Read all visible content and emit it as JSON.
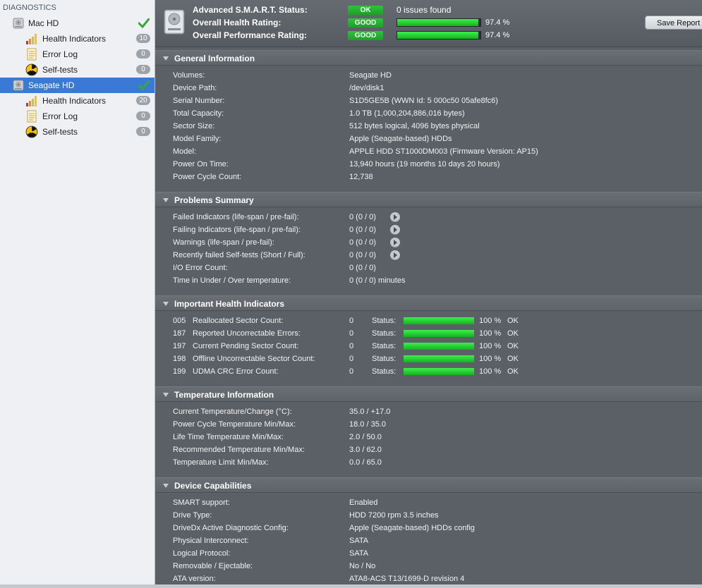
{
  "sidebar": {
    "section_title": "DIAGNOSTICS",
    "drives": [
      {
        "name": "Mac HD",
        "selected": false,
        "children": [
          {
            "label": "Health Indicators",
            "icon": "bar-chart-icon",
            "count": "10"
          },
          {
            "label": "Error Log",
            "icon": "document-icon",
            "count": "0"
          },
          {
            "label": "Self-tests",
            "icon": "radiation-icon",
            "count": "0"
          }
        ]
      },
      {
        "name": "Seagate HD",
        "selected": true,
        "children": [
          {
            "label": "Health Indicators",
            "icon": "bar-chart-icon",
            "count": "20"
          },
          {
            "label": "Error Log",
            "icon": "document-icon",
            "count": "0"
          },
          {
            "label": "Self-tests",
            "icon": "radiation-icon",
            "count": "0"
          }
        ]
      }
    ]
  },
  "summary": {
    "smart_status_label": "Advanced S.M.A.R.T. Status:",
    "smart_status_value": "OK",
    "issues": "0 issues found",
    "health_label": "Overall Health Rating:",
    "health_value": "GOOD",
    "health_level": 0.974,
    "health_pct": "97.4 %",
    "performance_label": "Overall Performance Rating:",
    "performance_value": "GOOD",
    "performance_level": 0.974,
    "performance_pct": "97.4 %",
    "save_button": "Save Report"
  },
  "colors": {
    "good_green": "#22b22e",
    "selected_blue": "#3b79d6",
    "panel_bg": "#5b6066"
  },
  "general": {
    "title": "General Information",
    "rows": [
      {
        "label": "Volumes:",
        "value": "Seagate HD"
      },
      {
        "label": "Device Path:",
        "value": "/dev/disk1"
      },
      {
        "label": "Serial Number:",
        "value": "S1D5GE5B (WWN Id: 5 000c50 05afe8fc6)"
      },
      {
        "label": "Total Capacity:",
        "value": "1.0 TB (1,000,204,886,016 bytes)"
      },
      {
        "label": "Sector Size:",
        "value": "512 bytes logical, 4096 bytes physical"
      },
      {
        "label": "Model Family:",
        "value": "Apple (Seagate-based) HDDs"
      },
      {
        "label": "Model:",
        "value": "APPLE HDD ST1000DM003  (Firmware Version: AP15)"
      },
      {
        "label": "Power On Time:",
        "value": "13,940 hours (19 months 10 days 20 hours)"
      },
      {
        "label": "Power Cycle Count:",
        "value": "12,738"
      }
    ]
  },
  "problems": {
    "title": "Problems Summary",
    "rows": [
      {
        "label": "Failed Indicators (life-span / pre-fail):",
        "value": "0 (0 / 0)",
        "arrow": true
      },
      {
        "label": "Failing Indicators (life-span / pre-fail):",
        "value": "0 (0 / 0)",
        "arrow": true
      },
      {
        "label": "Warnings (life-span / pre-fail):",
        "value": "0 (0 / 0)",
        "arrow": true
      },
      {
        "label": "Recently failed Self-tests (Short / Full):",
        "value": "0 (0 / 0)",
        "arrow": true
      },
      {
        "label": "I/O Error Count:",
        "value": "0 (0 / 0)",
        "arrow": false
      },
      {
        "label": "Time in Under / Over temperature:",
        "value": "0 (0 / 0)  minutes",
        "arrow": false
      }
    ]
  },
  "health": {
    "title": "Important Health Indicators",
    "status_label": "Status:",
    "rows": [
      {
        "code": "005",
        "name": "Reallocated Sector Count:",
        "value": "0",
        "level": 1.0,
        "pct": "100 %",
        "state": "OK"
      },
      {
        "code": "187",
        "name": "Reported Uncorrectable Errors:",
        "value": "0",
        "level": 1.0,
        "pct": "100 %",
        "state": "OK"
      },
      {
        "code": "197",
        "name": "Current Pending Sector Count:",
        "value": "0",
        "level": 1.0,
        "pct": "100 %",
        "state": "OK"
      },
      {
        "code": "198",
        "name": "Offline Uncorrectable Sector Count:",
        "value": "0",
        "level": 1.0,
        "pct": "100 %",
        "state": "OK"
      },
      {
        "code": "199",
        "name": "UDMA CRC Error Count:",
        "value": "0",
        "level": 1.0,
        "pct": "100 %",
        "state": "OK"
      }
    ]
  },
  "temperature": {
    "title": "Temperature Information",
    "rows": [
      {
        "label": "Current Temperature/Change (°C):",
        "value": "35.0 / +17.0"
      },
      {
        "label": "Power Cycle Temperature Min/Max:",
        "value": "18.0 / 35.0"
      },
      {
        "label": "Life Time Temperature Min/Max:",
        "value": "2.0   / 50.0"
      },
      {
        "label": "Recommended Temperature Min/Max:",
        "value": "3.0   / 62.0"
      },
      {
        "label": "Temperature Limit Min/Max:",
        "value": "0.0   / 65.0"
      }
    ]
  },
  "capabilities": {
    "title": "Device Capabilities",
    "rows": [
      {
        "label": "SMART support:",
        "value": "Enabled"
      },
      {
        "label": "Drive Type:",
        "value": "HDD 7200 rpm 3.5 inches"
      },
      {
        "label": "DriveDx Active Diagnostic Config:",
        "value": "Apple (Seagate-based) HDDs config"
      },
      {
        "label": "Physical Interconnect:",
        "value": "SATA"
      },
      {
        "label": "Logical Protocol:",
        "value": "SATA"
      },
      {
        "label": "Removable / Ejectable:",
        "value": "No / No"
      },
      {
        "label": "ATA version:",
        "value": "ATA8-ACS T13/1699-D revision 4"
      }
    ]
  }
}
